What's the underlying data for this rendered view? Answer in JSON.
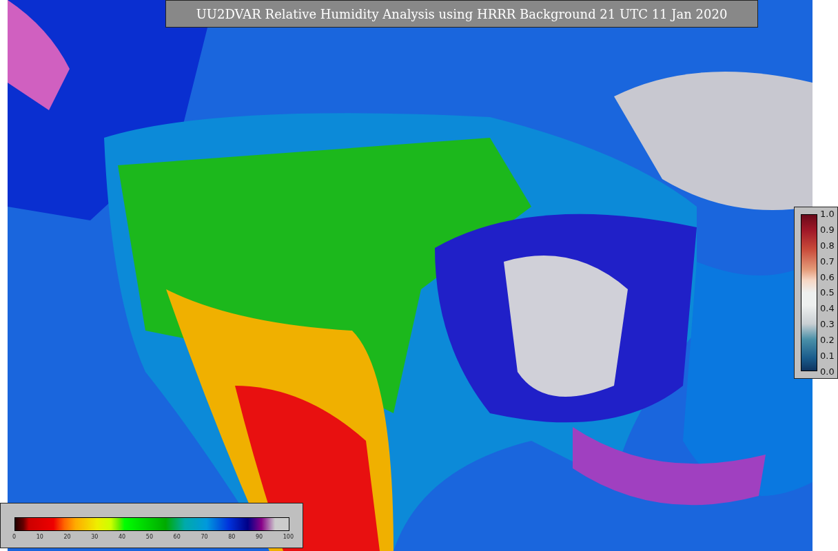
{
  "title": "UU2DVAR Relative Humidity Analysis using HRRR Background 21 UTC 11 Jan 2020",
  "horizontal_colorbar": {
    "ticks": [
      "0",
      "10",
      "20",
      "30",
      "40",
      "50",
      "60",
      "70",
      "80",
      "90",
      "100"
    ]
  },
  "vertical_colorbar": {
    "ticks": [
      "1.0",
      "0.9",
      "0.8",
      "0.7",
      "0.6",
      "0.5",
      "0.4",
      "0.3",
      "0.2",
      "0.1",
      "0.0"
    ]
  }
}
